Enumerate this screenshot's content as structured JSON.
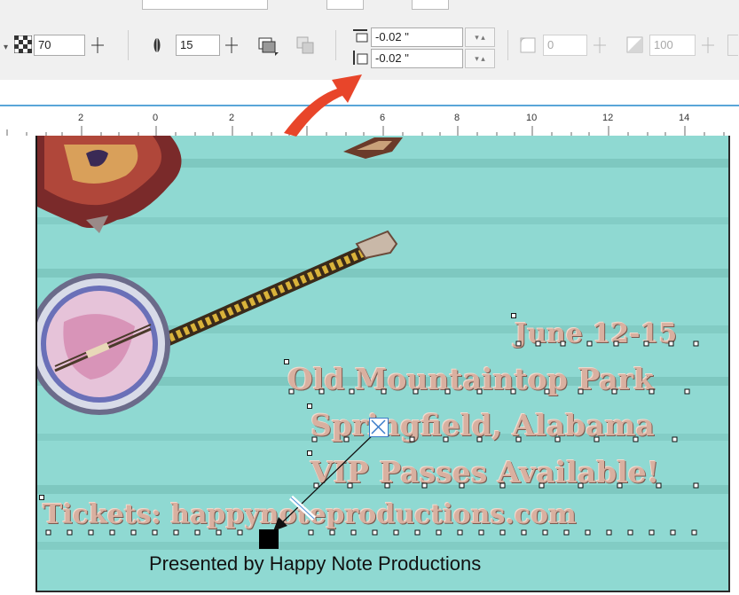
{
  "toolbar": {
    "transparency_value": "70",
    "feather_value": "15",
    "offset_x": "-0.02 \"",
    "offset_y": "-0.02 \"",
    "corner_value": "0",
    "opacity_value": "100"
  },
  "ruler": {
    "labels": [
      "2",
      "0",
      "2",
      "4",
      "6",
      "8",
      "10",
      "12",
      "14"
    ]
  },
  "poster": {
    "line1": "June 12-15",
    "line2": "Old Mountaintop Park",
    "line3": "Springfield, Alabama",
    "line4": "VIP Passes Available!",
    "line5": "Tickets: happynoteproductions.com",
    "presented": "Presented by Happy Note Productions"
  },
  "colors": {
    "canvas_bg": "#8fd9d2",
    "poster_text": "#d9b0a0",
    "arrow": "#e8452a",
    "ruler_accent": "#5aa6d8"
  }
}
